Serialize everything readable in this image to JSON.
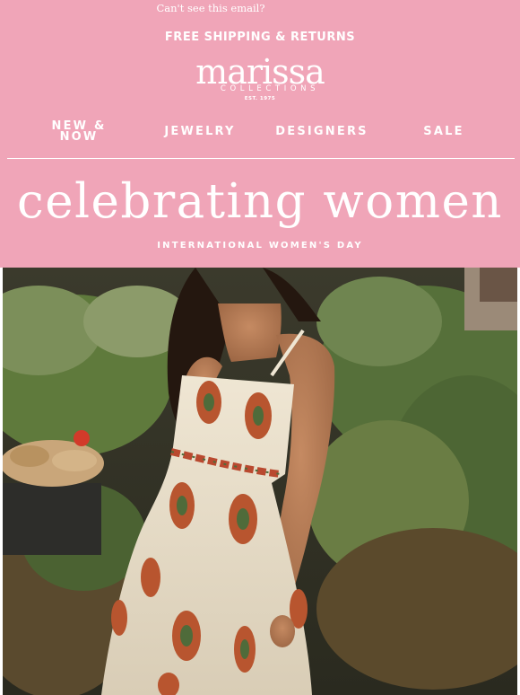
{
  "preheader": {
    "text": "Can't see this email?"
  },
  "banner": {
    "shipping": "FREE SHIPPING & RETURNS"
  },
  "brand": {
    "name": "marissa",
    "subline": "COLLECTIONS",
    "established": "EST. 1975"
  },
  "nav": [
    {
      "line1": "NEW &",
      "line2": "NOW"
    },
    {
      "label": "JEWELRY"
    },
    {
      "label": "DESIGNERS"
    },
    {
      "label": "SALE"
    }
  ],
  "hero": {
    "headline": "celebrating women",
    "subheadline": "INTERNATIONAL WOMEN'S DAY"
  },
  "colors": {
    "background": "#f0a5b8",
    "text": "#ffffff"
  },
  "image": {
    "description_icon": "hero-photo"
  }
}
